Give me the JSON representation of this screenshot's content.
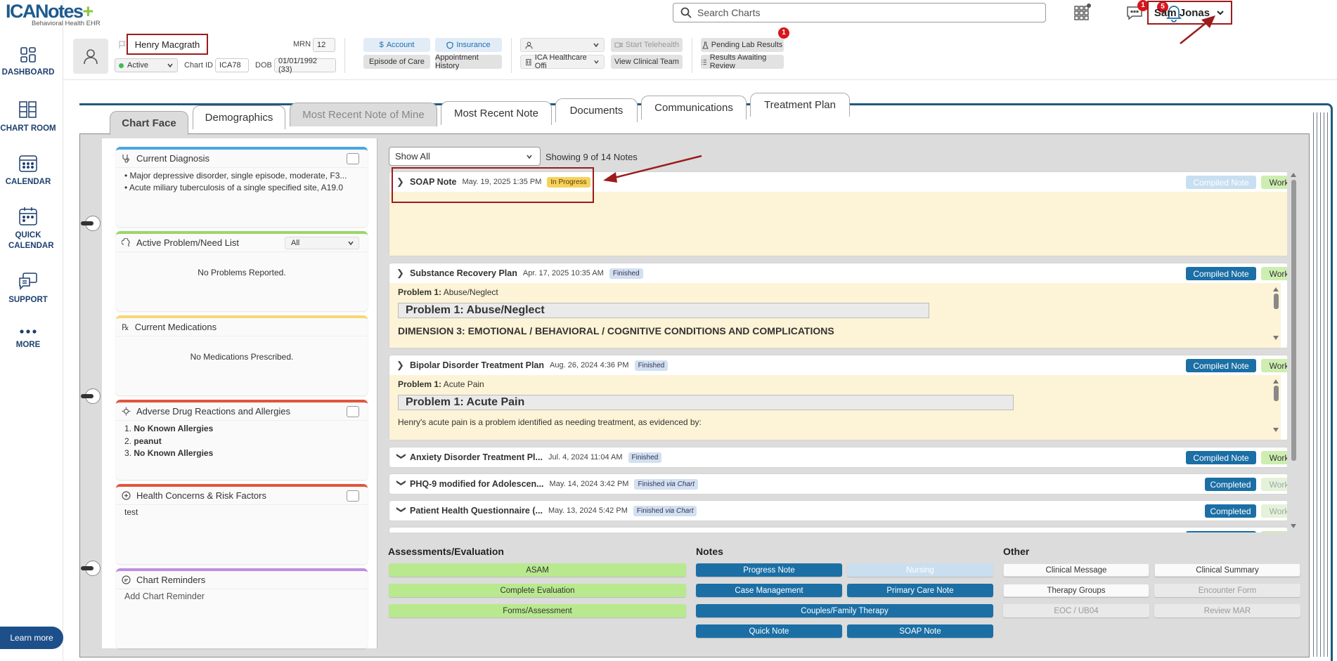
{
  "brand": {
    "name": "ICANotes",
    "plus": "+",
    "tagline": "Behavioral Health EHR"
  },
  "sidebar": {
    "items": [
      {
        "label": "DASHBOARD",
        "icon": "dashboard-icon"
      },
      {
        "label": "CHART ROOM",
        "icon": "chart-room-icon"
      },
      {
        "label": "CALENDAR",
        "icon": "calendar-icon"
      },
      {
        "label": "QUICK CALENDAR",
        "icon": "quick-calendar-icon"
      },
      {
        "label": "SUPPORT",
        "icon": "support-icon"
      },
      {
        "label": "MORE",
        "icon": "more-icon"
      }
    ],
    "learn_more": "Learn more"
  },
  "topbar": {
    "search_placeholder": "Search Charts",
    "messages_badge": "1",
    "notifications_badge": "5",
    "user_name": "Sam Jonas"
  },
  "patient": {
    "name": "Henry Macgrath",
    "mrn_label": "MRN",
    "mrn": "12",
    "status": "Active",
    "chart_id_label": "Chart ID",
    "chart_id": "ICA78",
    "dob_label": "DOB",
    "dob": "01/01/1992 (33)",
    "account": "Account",
    "insurance": "Insurance",
    "episode_of_care": "Episode of Care",
    "appointment_history": "Appointment History",
    "start_telehealth": "Start Telehealth",
    "facility": "ICA Healthcare Offi",
    "view_clinical_team": "View Clinical Team",
    "pending_lab_results": "Pending Lab Results",
    "pending_lab_badge": "1",
    "results_awaiting_review": "Results Awaiting Review"
  },
  "tabs": [
    {
      "label": "Chart Face",
      "state": "active"
    },
    {
      "label": "Demographics",
      "state": "normal"
    },
    {
      "label": "Most Recent Note of Mine",
      "state": "grey"
    },
    {
      "label": "Most Recent Note",
      "state": "normal"
    },
    {
      "label": "Documents",
      "state": "normal"
    },
    {
      "label": "Communications",
      "state": "normal"
    },
    {
      "label": "Treatment Plan",
      "state": "normal"
    }
  ],
  "widgets": {
    "diagnosis": {
      "title": "Current Diagnosis",
      "items": [
        "Major depressive disorder, single episode, moderate, F3...",
        "Acute miliary tuberculosis of a single specified site, A19.0"
      ]
    },
    "problems": {
      "title": "Active Problem/Need List",
      "filter": "All",
      "empty": "No Problems Reported."
    },
    "medications": {
      "title": "Current Medications",
      "empty": "No Medications Prescribed."
    },
    "allergies": {
      "title": "Adverse Drug Reactions and Allergies",
      "items": [
        {
          "num": "1.",
          "text": "No Known Allergies"
        },
        {
          "num": "2.",
          "text": "peanut"
        },
        {
          "num": "3.",
          "text": "No Known Allergies"
        }
      ]
    },
    "health": {
      "title": "Health Concerns & Risk Factors",
      "text": "test"
    },
    "reminders": {
      "title": "Chart Reminders",
      "add": "Add Chart Reminder"
    }
  },
  "notes": {
    "filter": "Show All",
    "showing": "Showing 9 of 14 Notes",
    "list": [
      {
        "title": "SOAP Note",
        "date": "May. 19, 2025 1:35 PM",
        "status": "In Progress",
        "compiled": "Compiled Note",
        "work": "Work Area"
      },
      {
        "title": "Substance Recovery Plan",
        "date": "Apr. 17, 2025 10:35 AM",
        "status": "Finished",
        "compiled": "Compiled Note",
        "work": "Work Area",
        "problem_label": "Problem 1:",
        "problem_value": "Abuse/Neglect",
        "box": "Problem 1: Abuse/Neglect",
        "extra": "DIMENSION 3: EMOTIONAL / BEHAVIORAL / COGNITIVE CONDITIONS AND COMPLICATIONS"
      },
      {
        "title": "Bipolar Disorder Treatment Plan",
        "date": "Aug. 26, 2024 4:36 PM",
        "status": "Finished",
        "compiled": "Compiled Note",
        "work": "Work Area",
        "problem_label": "Problem 1:",
        "problem_value": "Acute Pain",
        "box": "Problem 1: Acute Pain",
        "extra": "Henry's acute pain is a problem identified as needing treatment, as evidenced by:"
      },
      {
        "title": "Anxiety Disorder Treatment Pl...",
        "date": "Jul. 4, 2024 11:04 AM",
        "status": "Finished",
        "compiled": "Compiled Note",
        "work": "Work Area"
      },
      {
        "title": "PHQ-9 modified for Adolescen...",
        "date": "May. 14, 2024 3:42 PM",
        "status": "Finished",
        "status_via": "via Chart",
        "compiled": "Completed",
        "work": "Work Area"
      },
      {
        "title": "Patient Health Questionnaire (...",
        "date": "May. 13, 2024 5:42 PM",
        "status": "Finished",
        "status_via": "via Chart",
        "compiled": "Completed",
        "work": "Work Area"
      }
    ]
  },
  "assessments": {
    "title": "Assessments/Evaluation",
    "buttons": [
      "ASAM",
      "Complete Evaluation",
      "Forms/Assessment"
    ]
  },
  "notes_section": {
    "title": "Notes",
    "buttons": [
      "Progress Note",
      "Nursing",
      "Case Management",
      "Primary Care Note",
      "Couples/Family Therapy",
      "Quick Note",
      "SOAP Note"
    ]
  },
  "other_section": {
    "title": "Other",
    "buttons": [
      "Clinical Message",
      "Clinical Summary",
      "Therapy Groups",
      "Encounter Form",
      "EOC / UB04",
      "Review MAR"
    ]
  }
}
